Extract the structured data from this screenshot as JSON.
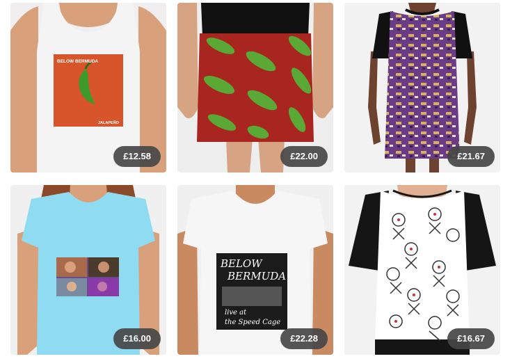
{
  "products": [
    {
      "type": "tank-top",
      "price": "£12.58",
      "print_text": "BELOW BERMUDA",
      "print_subtext": "JALAPEÑO",
      "colors": {
        "garment": "#f4f4f4",
        "print": "#d8552b",
        "pepper": "#3f9a2b"
      }
    },
    {
      "type": "mini-skirt",
      "price": "£22.00",
      "colors": {
        "garment": "#a8261f",
        "pepper": "#5aa836",
        "top": "#111111"
      }
    },
    {
      "type": "graphic-dress",
      "price": "£21.67",
      "colors": {
        "garment": "#6a3b86",
        "sleeves": "#111111",
        "accent": "#d7b25a"
      }
    },
    {
      "type": "fitted-t-shirt",
      "price": "£16.00",
      "colors": {
        "garment": "#8fdcf2",
        "print": "#6a4a8a"
      }
    },
    {
      "type": "premium-t-shirt",
      "price": "£22.28",
      "print_text_line1": "BELOW",
      "print_text_line2": "BERMUDA",
      "print_subtext_line1": "live at",
      "print_subtext_line2": "the Speed Cage",
      "colors": {
        "garment": "#f6f6f6",
        "print": "#1b1b1b"
      }
    },
    {
      "type": "chiffon-top",
      "price": "£16.67",
      "colors": {
        "garment": "#ffffff",
        "sleeves": "#151515",
        "pattern": "#333333",
        "accent": "#cc3333"
      }
    }
  ]
}
